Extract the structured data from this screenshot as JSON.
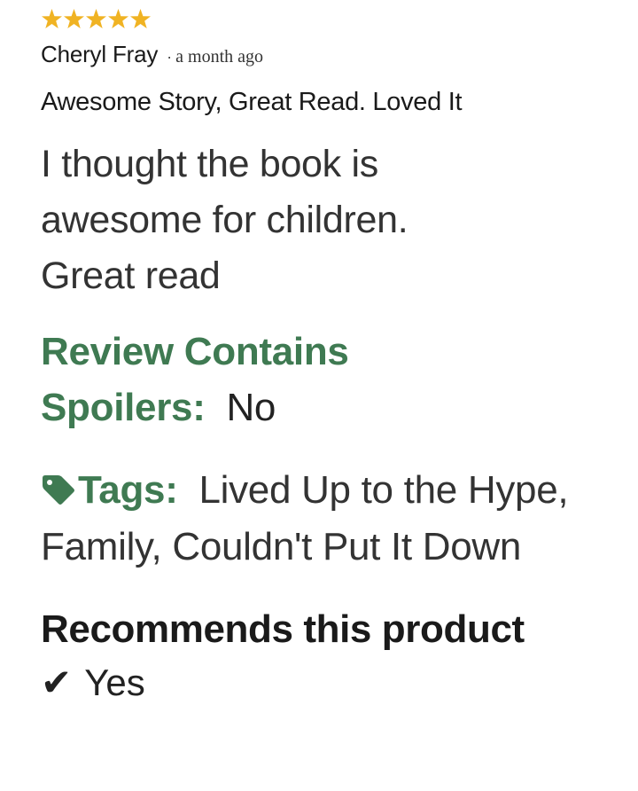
{
  "review": {
    "rating": 5,
    "rating_max": 5,
    "star_color": "#F0B323",
    "author": "Cheryl Fray",
    "separator": "·",
    "posted_time": "a month ago",
    "headline": "Awesome Story, Great Read. Loved It",
    "body_line_1": "I thought the book is",
    "body_line_2": "awesome for children.",
    "body_line_3": "Great read",
    "spoilers": {
      "label_line_1": "Review Contains",
      "label_line_2": "Spoilers:",
      "value": "No"
    },
    "tags": {
      "icon": "tag-icon",
      "label": "Tags:",
      "items": [
        "Lived Up to the Hype",
        "Family",
        "Couldn't Put It Down"
      ]
    },
    "recommends": {
      "label": "Recommends this product",
      "icon": "check-icon",
      "value": "Yes"
    },
    "accent_green": "#3F7A52"
  }
}
